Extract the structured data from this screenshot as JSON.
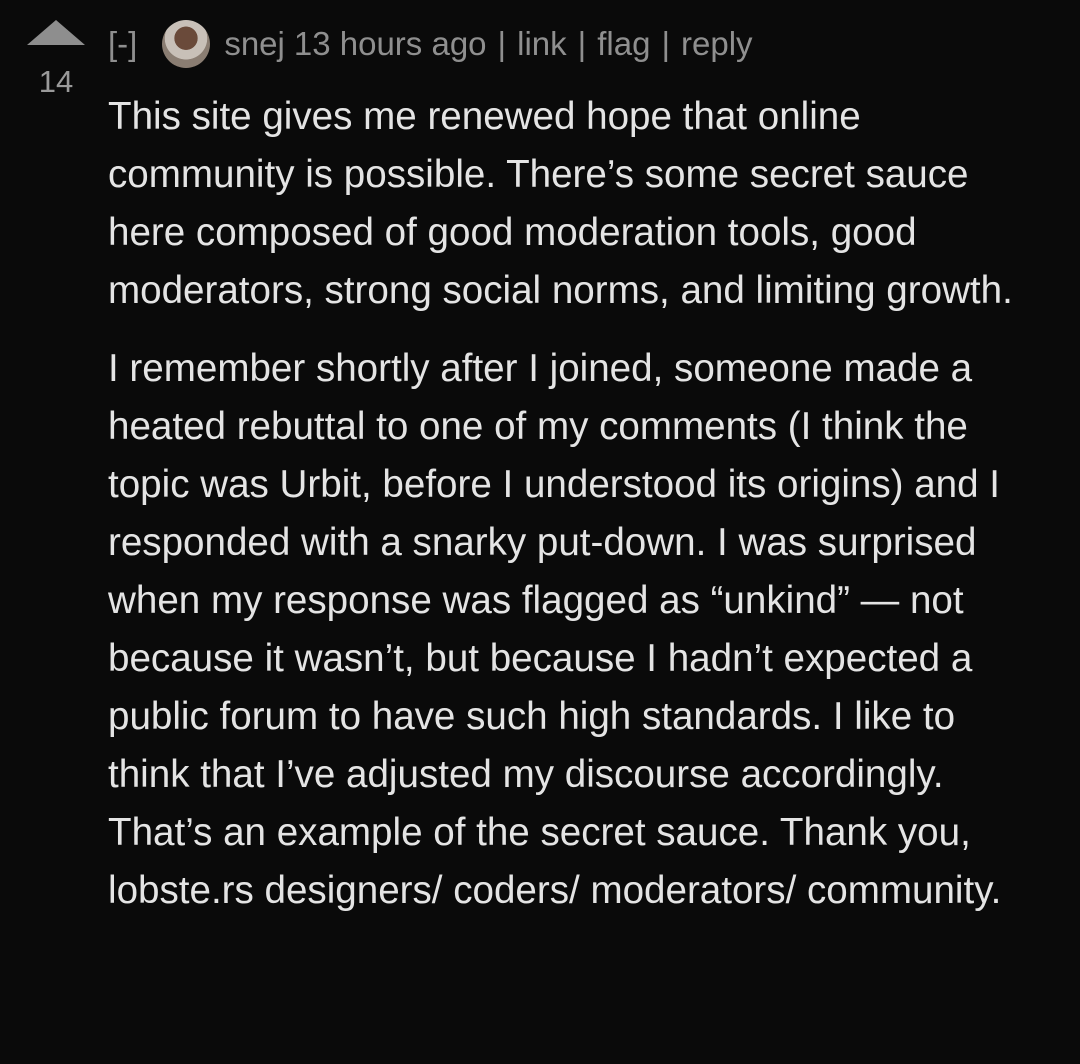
{
  "comment": {
    "score": "14",
    "collapse_label": "[-]",
    "author": "snej",
    "time": "13 hours ago",
    "actions": {
      "link": "link",
      "flag": "flag",
      "reply": "reply"
    },
    "separator": "|",
    "paragraphs": [
      "This site gives me renewed hope that online community is possible. There’s some secret sauce here composed of good moderation tools, good moderators, strong social norms, and limiting growth.",
      "I remember shortly after I joined, someone made a heated rebuttal to one of my comments (I think the topic was Urbit, before I understood its origins) and I responded with a snarky put-down. I was surprised when my response was flagged as “unkind” — not because it wasn’t, but because I hadn’t expected a public forum to have such high standards. I like to think that I’ve adjusted my discourse accordingly. That’s an example of the secret sauce. Thank you, lobste.rs designers/ coders/ moderators/ community."
    ]
  },
  "icons": {
    "upvote": "upvote-arrow-icon",
    "avatar": "user-avatar"
  },
  "colors": {
    "background": "#0a0a0a",
    "body_text": "#e4e4e4",
    "meta_text": "#8f8f8f",
    "upvote_arrow": "#8e8e8e"
  }
}
